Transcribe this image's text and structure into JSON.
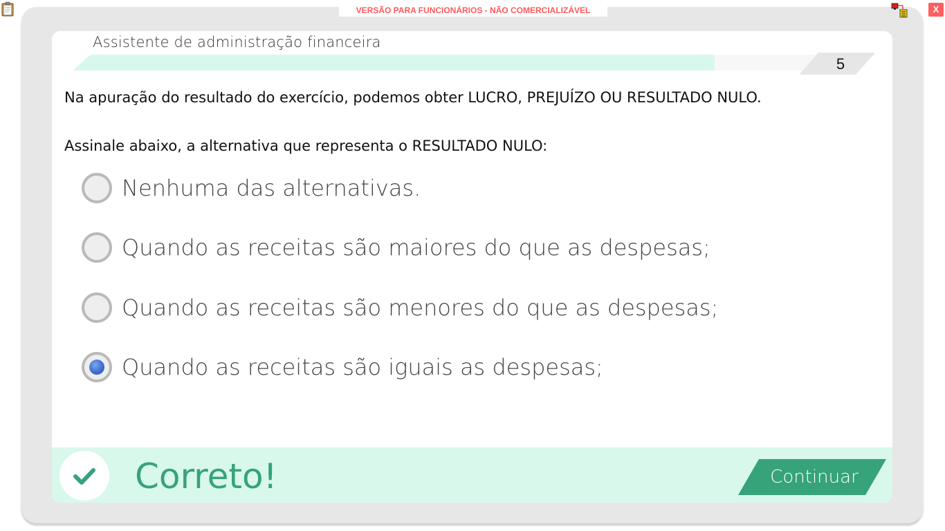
{
  "window": {
    "watermark": "VERSÃO PARA FUNCIONÁRIOS - NÃO COMERCIALIZÁVEL",
    "close_label": "X",
    "clipboard_icon": "clipboard-icon",
    "tray_icon": "network-status-icon"
  },
  "header": {
    "title": "Assistente de administração financeira",
    "step_number": "5",
    "progress_fraction": 0.8
  },
  "question": {
    "statement": "Na apuração do resultado do exercício, podemos obter LUCRO, PREJUÍZO OU RESULTADO NULO.",
    "instruction": "Assinale abaixo, a alternativa que representa o RESULTADO NULO:",
    "selected_index": 3,
    "options": [
      {
        "label": "Nenhuma das alternativas."
      },
      {
        "label": "Quando as receitas são maiores do que as despesas;"
      },
      {
        "label": "Quando as receitas são menores do que as despesas;"
      },
      {
        "label": "Quando as receitas são iguais as despesas;"
      }
    ]
  },
  "feedback": {
    "status_text": "Correto!",
    "status_icon": "check-icon",
    "continue_label": "Continuar"
  },
  "colors": {
    "accent_green": "#36a37a",
    "light_green": "#d9f8ec",
    "radio_selected": "#3f6fd0",
    "watermark_red": "#ff5a5a"
  }
}
